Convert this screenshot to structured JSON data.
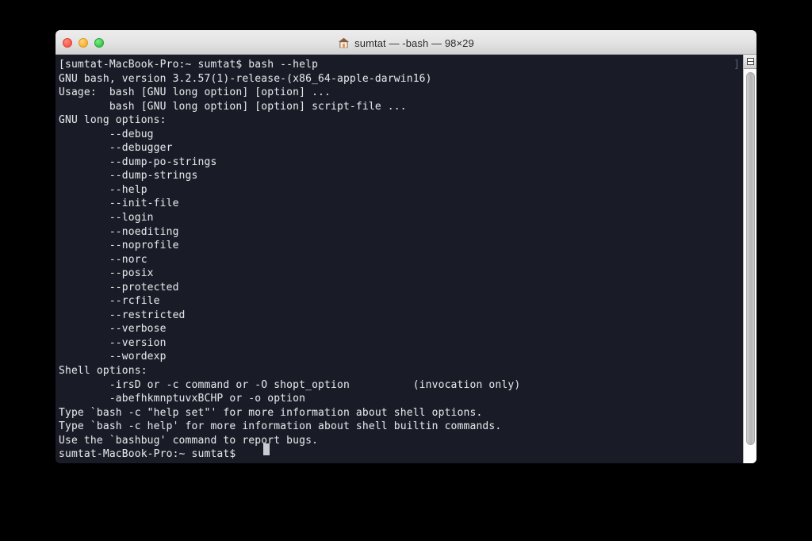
{
  "window": {
    "title": "sumtat — -bash — 98×29",
    "title_icon": "house-icon",
    "size_columns": 98,
    "size_rows": 29,
    "controls": {
      "close_label": "Close",
      "minimize_label": "Minimize",
      "maximize_label": "Zoom"
    },
    "colors": {
      "titlebar_top": "#ececec",
      "titlebar_bottom": "#d2d2d2",
      "terminal_background": "#191c26",
      "terminal_foreground": "#e3e4e8",
      "close_button": "#f7564a",
      "minimize_button": "#f9b229",
      "maximize_button": "#33c748",
      "cursor": "#c9cbd2",
      "edge_marker": "#5b6076"
    }
  },
  "terminal": {
    "prompt_host": "sumtat-MacBook-Pro",
    "prompt_path": "~",
    "prompt_user": "sumtat",
    "prompt_symbol": "$",
    "command_entered": "bash --help",
    "edge_marker": "]",
    "cursor_glyph": "block",
    "lines": [
      "[sumtat-MacBook-Pro:~ sumtat$ bash --help",
      "GNU bash, version 3.2.57(1)-release-(x86_64-apple-darwin16)",
      "Usage:\tbash [GNU long option] [option] ...",
      "\tbash [GNU long option] [option] script-file ...",
      "GNU long options:",
      "\t--debug",
      "\t--debugger",
      "\t--dump-po-strings",
      "\t--dump-strings",
      "\t--help",
      "\t--init-file",
      "\t--login",
      "\t--noediting",
      "\t--noprofile",
      "\t--norc",
      "\t--posix",
      "\t--protected",
      "\t--rcfile",
      "\t--restricted",
      "\t--verbose",
      "\t--version",
      "\t--wordexp",
      "Shell options:",
      "\t-irsD or -c command or -O shopt_option\t\t(invocation only)",
      "\t-abefhkmnptuvxBCHP or -o option",
      "Type `bash -c \"help set\"' for more information about shell options.",
      "Type `bash -c help' for more information about shell builtin commands.",
      "Use the `bashbug' command to report bugs.",
      "sumtat-MacBook-Pro:~ sumtat$ "
    ],
    "long_options": [
      "--debug",
      "--debugger",
      "--dump-po-strings",
      "--dump-strings",
      "--help",
      "--init-file",
      "--login",
      "--noediting",
      "--noprofile",
      "--norc",
      "--posix",
      "--protected",
      "--rcfile",
      "--restricted",
      "--verbose",
      "--version",
      "--wordexp"
    ],
    "shell_options": [
      "-irsD or -c command or -O shopt_option",
      "-abefhkmnptuvxBCHP or -o option"
    ],
    "shell_options_note": "(invocation only)",
    "version_string": "GNU bash, version 3.2.57(1)-release-(x86_64-apple-darwin16)",
    "footer_lines": [
      "Type `bash -c \"help set\"' for more information about shell options.",
      "Type `bash -c help' for more information about shell builtin commands.",
      "Use the `bashbug' command to report bugs."
    ]
  },
  "scrollbar": {
    "split_pane_label": "Split pane",
    "position_percent": 100
  }
}
